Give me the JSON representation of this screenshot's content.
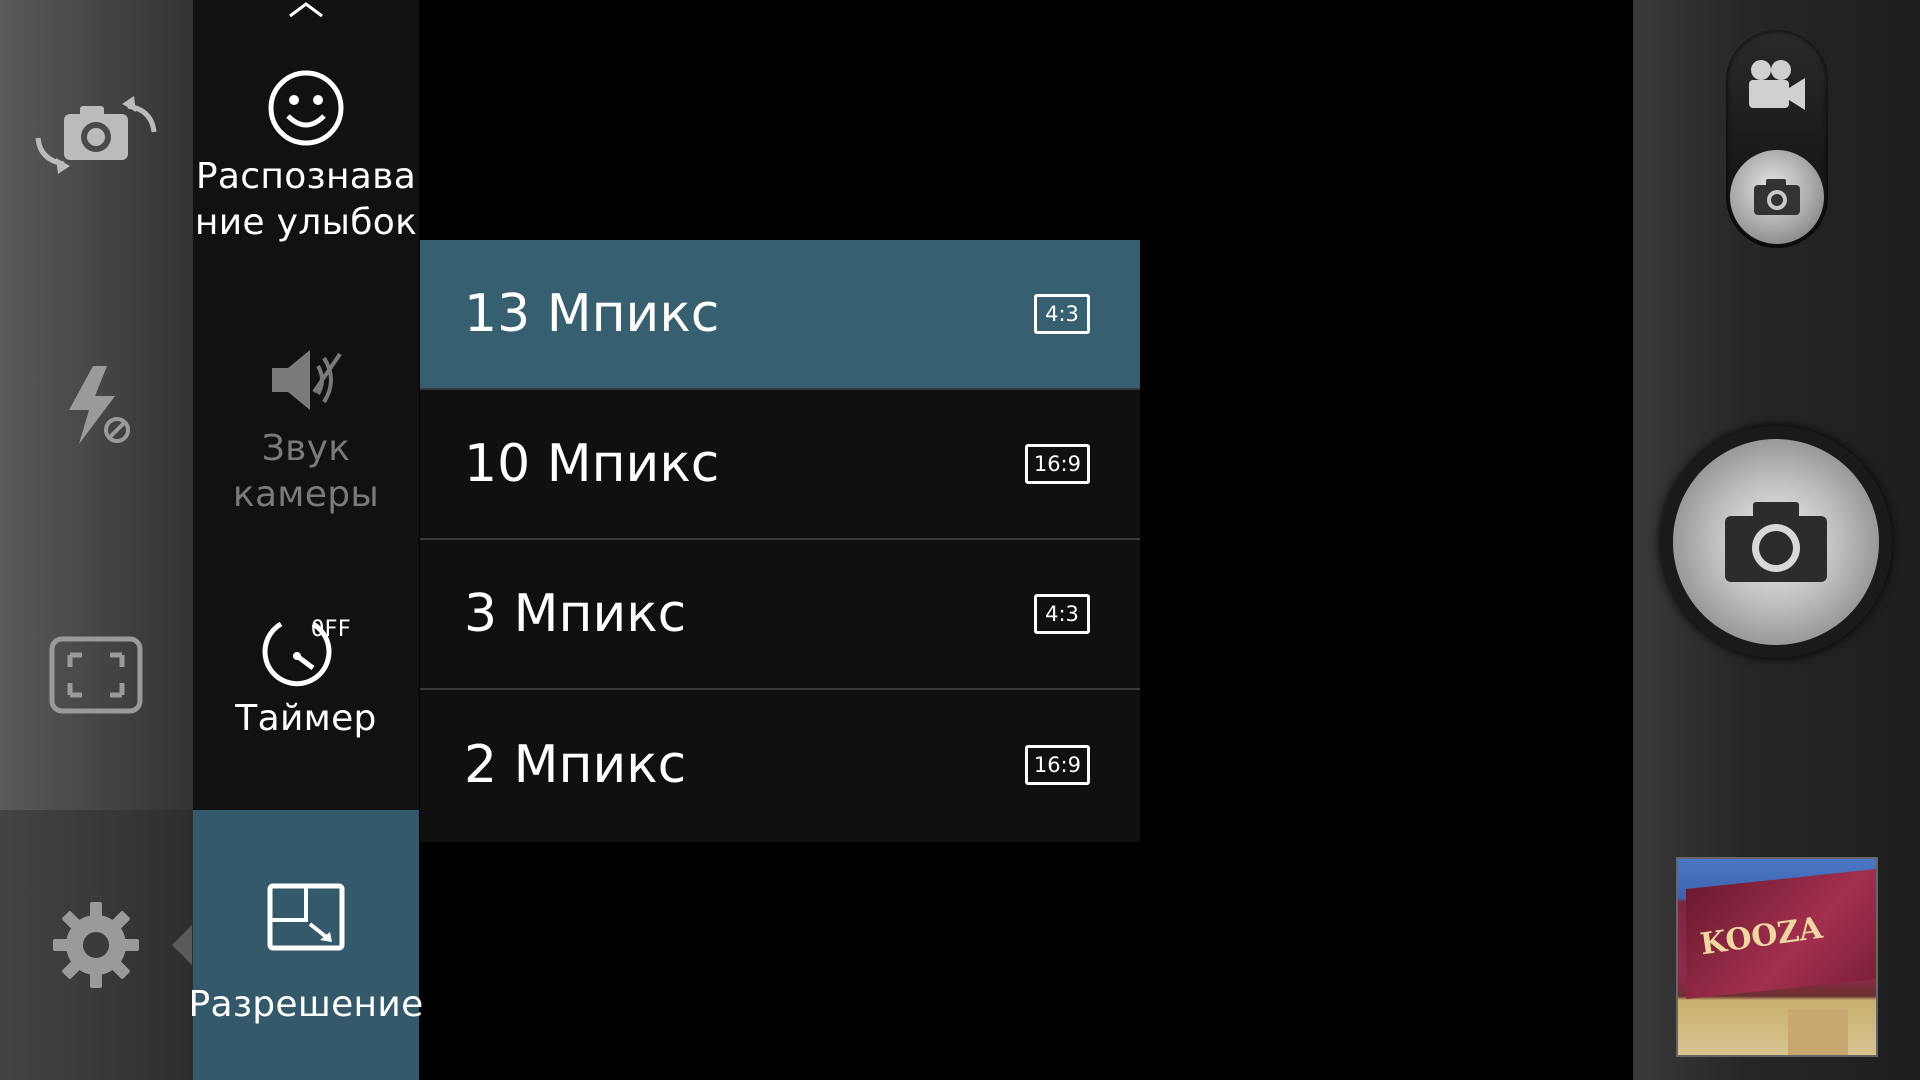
{
  "left_toolbar": {
    "icons": [
      "switch-camera-icon",
      "flash-off-icon",
      "shooting-mode-icon",
      "settings-icon"
    ]
  },
  "menu": {
    "items": [
      {
        "label": "Распознава\nние улыбок",
        "icon": "smile-icon"
      },
      {
        "label": "Звук\nкамеры",
        "icon": "camera-sound-icon"
      },
      {
        "label": "Таймер",
        "icon": "timer-off-icon"
      },
      {
        "label": "Разрешение",
        "icon": "resolution-icon"
      }
    ]
  },
  "resolution_options": [
    {
      "label": "13 Мпикс",
      "ratio": "4:3",
      "selected": true
    },
    {
      "label": "10 Мпикс",
      "ratio": "16:9",
      "selected": false
    },
    {
      "label": "3 Мпикс",
      "ratio": "4:3",
      "selected": false
    },
    {
      "label": "2 Мпикс",
      "ratio": "16:9",
      "selected": false
    }
  ],
  "right_panel": {
    "mode_icons": [
      "video-camera-icon",
      "photo-camera-icon"
    ],
    "shutter_icon": "camera-icon",
    "thumbnail_text": "KOOZA"
  },
  "colors": {
    "accent": "#36606f",
    "menu_bg": "#111111"
  }
}
